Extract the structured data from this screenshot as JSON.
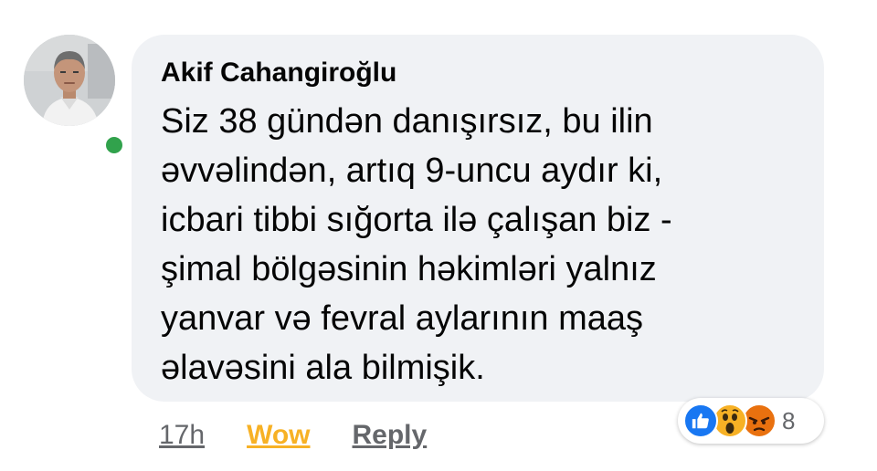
{
  "comment": {
    "author": "Akif Cahangiroğlu",
    "lines": [
      "Siz 38 gündən danışırsız, bu ilin",
      "əvvəlindən, artıq 9-uncu aydır ki,",
      "icbari tibbi sığorta ilə çalışan biz -",
      "şimal bölgəsinin həkimləri yalnız",
      "yanvar və fevral aylarının maaş",
      "əlavəsini ala bilmişik."
    ],
    "online": true
  },
  "actions": {
    "timestamp": "17h",
    "reaction_label": "Wow",
    "reply_label": "Reply"
  },
  "reactions": {
    "icons": [
      "like-icon",
      "wow-icon",
      "angry-icon"
    ],
    "count": "8"
  },
  "colors": {
    "bubble": "#f0f2f5",
    "online": "#31a24c",
    "wow": "#f7b125",
    "secondary_text": "#65676b",
    "like": "#1877f2",
    "angry": "#e9710f"
  }
}
